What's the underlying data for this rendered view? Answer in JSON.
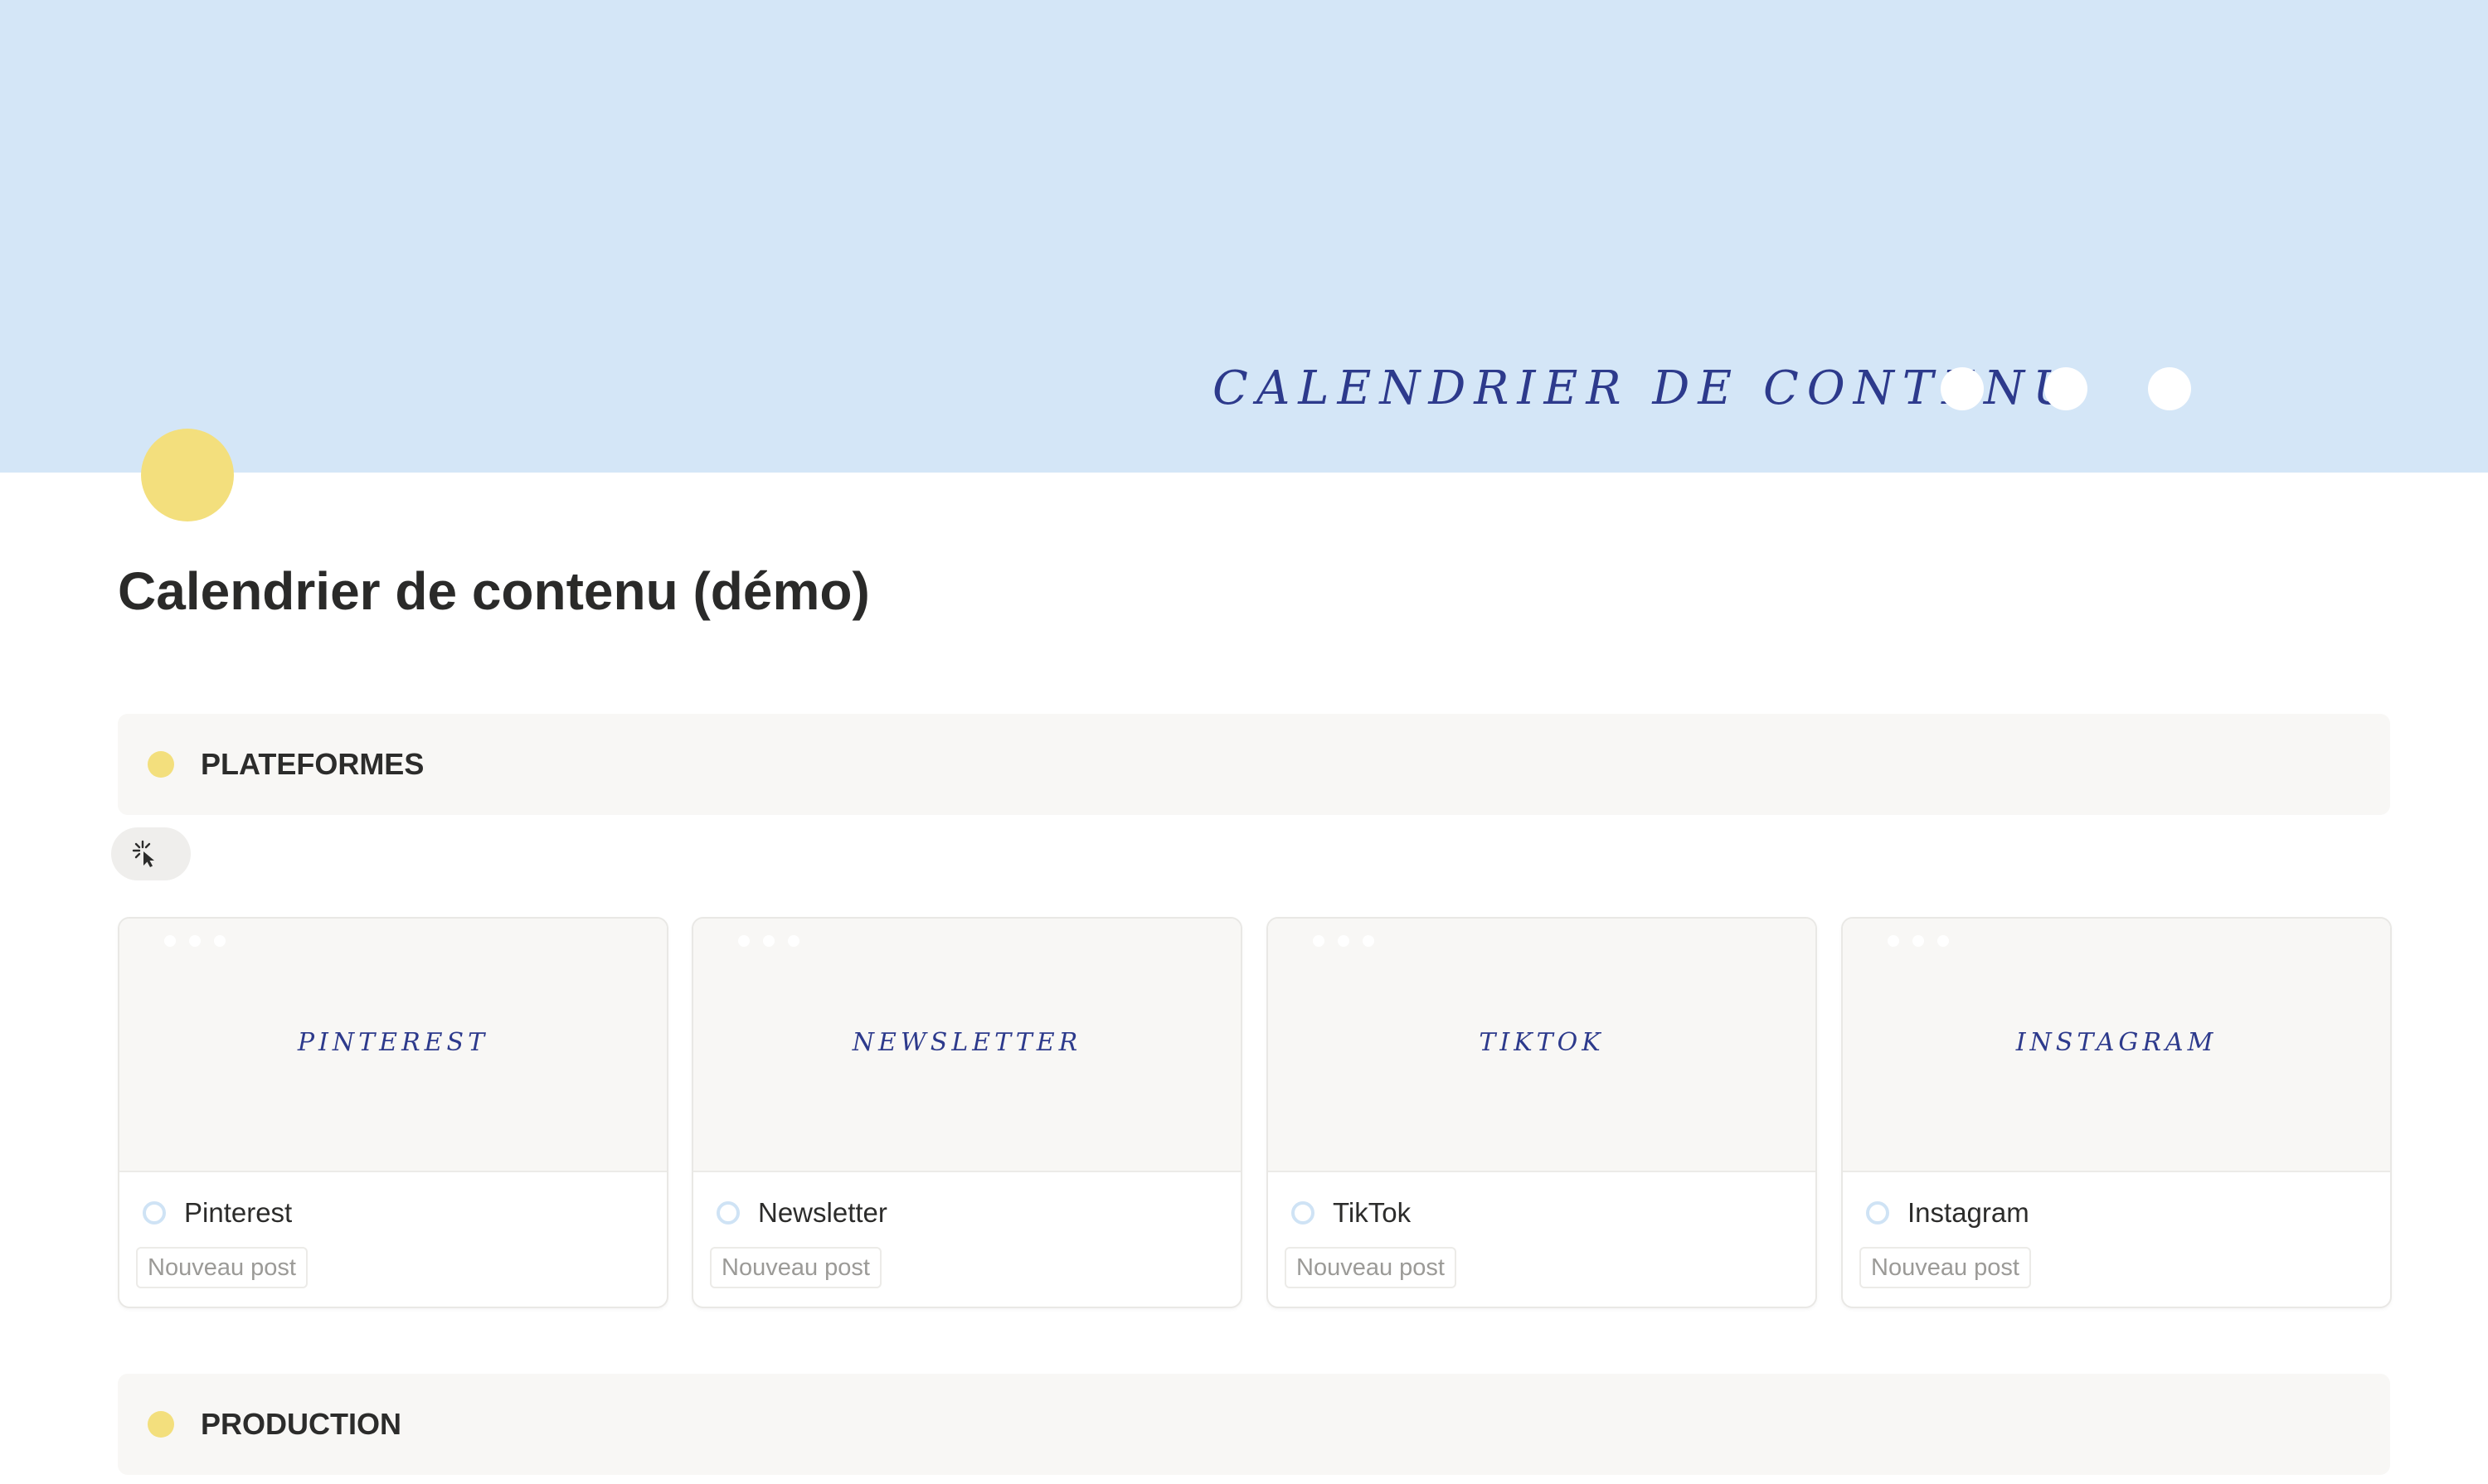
{
  "cover": {
    "title": "CALENDRIER DE CONTENU",
    "background_color": "#d4e6f7",
    "text_color": "#2d3a8c"
  },
  "page": {
    "icon": "yellow-circle-icon",
    "title": "Calendrier de contenu (démo)"
  },
  "sections": [
    {
      "label": "PLATEFORMES"
    },
    {
      "label": "PRODUCTION"
    }
  ],
  "loading_icon": "spinner-cursor-icon",
  "cards": [
    {
      "cover_text": "PINTEREST",
      "name": "Pinterest",
      "tag": "Nouveau post"
    },
    {
      "cover_text": "NEWSLETTER",
      "name": "Newsletter",
      "tag": "Nouveau post"
    },
    {
      "cover_text": "TIKTOK",
      "name": "TikTok",
      "tag": "Nouveau post"
    },
    {
      "cover_text": "INSTAGRAM",
      "name": "Instagram",
      "tag": "Nouveau post"
    }
  ],
  "colors": {
    "accent_yellow": "#f3df7d",
    "callout_bg": "#f8f7f5",
    "status_ring": "#cfe3f5"
  }
}
